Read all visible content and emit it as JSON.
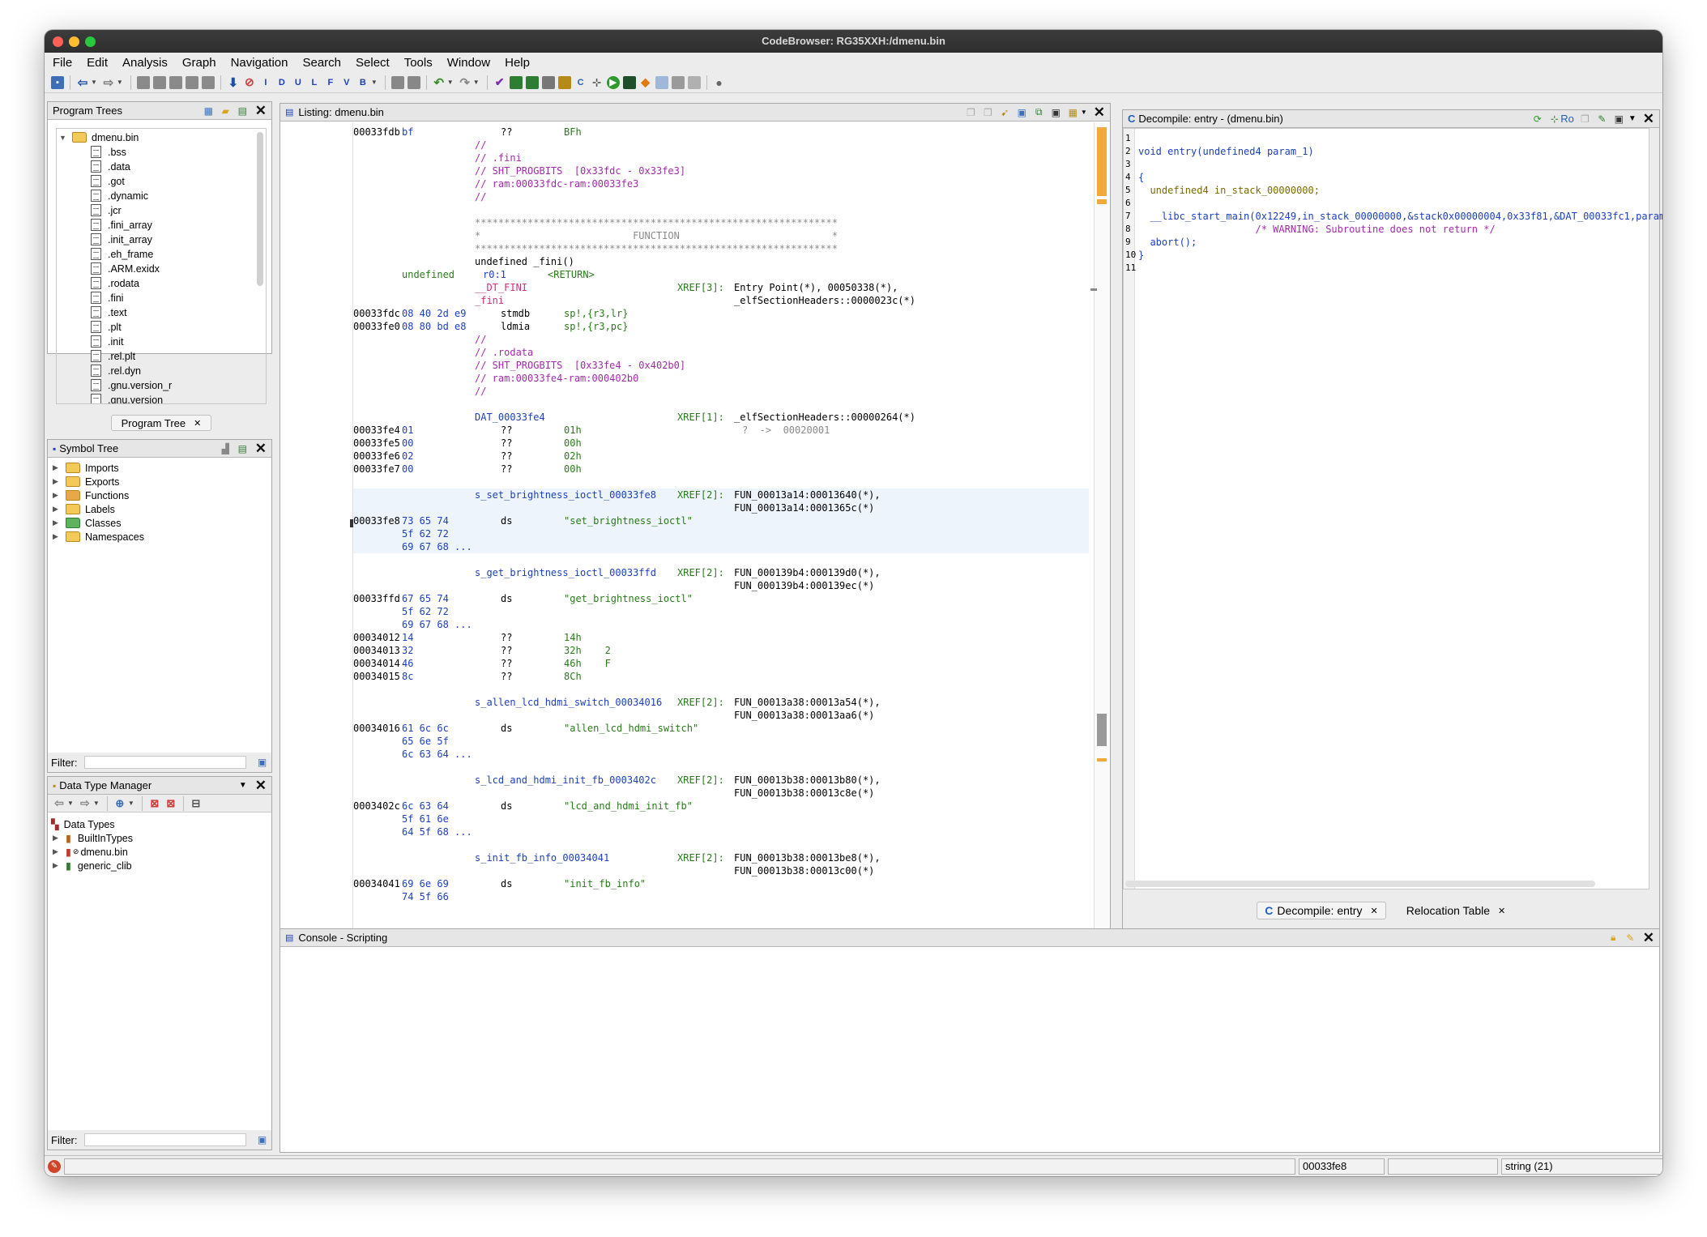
{
  "window": {
    "title": "CodeBrowser: RG35XXH:/dmenu.bin"
  },
  "menu": [
    "File",
    "Edit",
    "Analysis",
    "Graph",
    "Navigation",
    "Search",
    "Select",
    "Tools",
    "Window",
    "Help"
  ],
  "program_trees": {
    "title": "Program Trees",
    "root": "dmenu.bin",
    "items": [
      ".bss",
      ".data",
      ".got",
      ".dynamic",
      ".jcr",
      ".fini_array",
      ".init_array",
      ".eh_frame",
      ".ARM.exidx",
      ".rodata",
      ".fini",
      ".text",
      ".plt",
      ".init",
      ".rel.plt",
      ".rel.dyn",
      ".gnu.version_r",
      ".gnu.version"
    ],
    "tab": "Program Tree"
  },
  "symbol_tree": {
    "title": "Symbol Tree",
    "items": [
      "Imports",
      "Exports",
      "Functions",
      "Labels",
      "Classes",
      "Namespaces"
    ],
    "filter_label": "Filter:"
  },
  "data_type_manager": {
    "title": "Data Type Manager",
    "root": "Data Types",
    "items": [
      "BuiltInTypes",
      "dmenu.bin",
      "generic_clib"
    ],
    "filter_label": "Filter:"
  },
  "listing": {
    "title": "Listing:  dmenu.bin",
    "rows": [
      {
        "addr": "00033fdb",
        "bytes": "bf",
        "mnem": "??",
        "op": "BFh"
      },
      {
        "comment": "//"
      },
      {
        "comment": "// .fini"
      },
      {
        "comment": "// SHT_PROGBITS  [0x33fdc - 0x33fe3]"
      },
      {
        "comment": "// ram:00033fdc-ram:00033fe3"
      },
      {
        "comment": "//"
      },
      {},
      {
        "stars": "**************************************************************"
      },
      {
        "stars": "*                          FUNCTION                          *"
      },
      {
        "stars": "**************************************************************"
      },
      {
        "sig": "undefined _fini()"
      },
      {
        "ret_type": "undefined",
        "ret_reg": "r0:1",
        "ret_tag": "<RETURN>"
      },
      {
        "label_red": "__DT_FINI",
        "xref": "XREF[3]:",
        "xref_vals": "Entry Point(*), 00050338(*),"
      },
      {
        "label_red": "_fini",
        "xref_vals": "_elfSectionHeaders::0000023c(*)"
      },
      {
        "addr": "00033fdc",
        "bytes": "08 40 2d e9",
        "mnem": "stmdb",
        "op": "sp!,{r3,lr}"
      },
      {
        "addr": "00033fe0",
        "bytes": "08 80 bd e8",
        "mnem": "ldmia",
        "op": "sp!,{r3,pc}"
      },
      {
        "comment": "//"
      },
      {
        "comment": "// .rodata"
      },
      {
        "comment": "// SHT_PROGBITS  [0x33fe4 - 0x402b0]"
      },
      {
        "comment": "// ram:00033fe4-ram:000402b0"
      },
      {
        "comment": "//"
      },
      {},
      {
        "label": "DAT_00033fe4",
        "xref": "XREF[1]:",
        "xref_vals": "_elfSectionHeaders::00000264(*)"
      },
      {
        "addr": "00033fe4",
        "bytes": "01",
        "mnem": "??",
        "op": "01h",
        "extra_gray": "?  ->  00020001"
      },
      {
        "addr": "00033fe5",
        "bytes": "00",
        "mnem": "??",
        "op": "00h"
      },
      {
        "addr": "00033fe6",
        "bytes": "02",
        "mnem": "??",
        "op": "02h"
      },
      {
        "addr": "00033fe7",
        "bytes": "00",
        "mnem": "??",
        "op": "00h"
      },
      {},
      {
        "label": "s_set_brightness_ioctl_00033fe8",
        "xref": "XREF[2]:",
        "xref_vals": "FUN_00013a14:00013640(*),",
        "hl": true
      },
      {
        "xref_vals": "FUN_00013a14:0001365c(*)",
        "hl": true
      },
      {
        "addr": "00033fe8",
        "bytes": "73 65 74",
        "mnem": "ds",
        "str": "\"set_brightness_ioctl\"",
        "hl": true
      },
      {
        "bytes": "5f 62 72",
        "hl": true
      },
      {
        "bytes": "69 67 68 ...",
        "hl": true
      },
      {},
      {
        "label": "s_get_brightness_ioctl_00033ffd",
        "xref": "XREF[2]:",
        "xref_vals": "FUN_000139b4:000139d0(*),"
      },
      {
        "xref_vals": "FUN_000139b4:000139ec(*)"
      },
      {
        "addr": "00033ffd",
        "bytes": "67 65 74",
        "mnem": "ds",
        "str": "\"get_brightness_ioctl\""
      },
      {
        "bytes": "5f 62 72"
      },
      {
        "bytes": "69 67 68 ..."
      },
      {
        "addr": "00034012",
        "bytes": "14",
        "mnem": "??",
        "op": "14h"
      },
      {
        "addr": "00034013",
        "bytes": "32",
        "mnem": "??",
        "op": "32h    2"
      },
      {
        "addr": "00034014",
        "bytes": "46",
        "mnem": "??",
        "op": "46h    F"
      },
      {
        "addr": "00034015",
        "bytes": "8c",
        "mnem": "??",
        "op": "8Ch"
      },
      {},
      {
        "label": "s_allen_lcd_hdmi_switch_00034016",
        "xref": "XREF[2]:",
        "xref_vals": "FUN_00013a38:00013a54(*),"
      },
      {
        "xref_vals": "FUN_00013a38:00013aa6(*)"
      },
      {
        "addr": "00034016",
        "bytes": "61 6c 6c",
        "mnem": "ds",
        "str": "\"allen_lcd_hdmi_switch\""
      },
      {
        "bytes": "65 6e 5f"
      },
      {
        "bytes": "6c 63 64 ..."
      },
      {},
      {
        "label": "s_lcd_and_hdmi_init_fb_0003402c",
        "xref": "XREF[2]:",
        "xref_vals": "FUN_00013b38:00013b80(*),"
      },
      {
        "xref_vals": "FUN_00013b38:00013c8e(*)"
      },
      {
        "addr": "0003402c",
        "bytes": "6c 63 64",
        "mnem": "ds",
        "str": "\"lcd_and_hdmi_init_fb\""
      },
      {
        "bytes": "5f 61 6e"
      },
      {
        "bytes": "64 5f 68 ..."
      },
      {},
      {
        "label": "s_init_fb_info_00034041",
        "xref": "XREF[2]:",
        "xref_vals": "FUN_00013b38:00013be8(*),"
      },
      {
        "xref_vals": "FUN_00013b38:00013c00(*)"
      },
      {
        "addr": "00034041",
        "bytes": "69 6e 69",
        "mnem": "ds",
        "str": "\"init_fb_info\""
      },
      {
        "bytes": "74 5f 66"
      }
    ]
  },
  "decompile": {
    "title": "Decompile: entry -  (dmenu.bin)",
    "ro_label": "Ro",
    "lines": [
      "",
      "void entry(undefined4 param_1)",
      "",
      "{",
      "  undefined4 in_stack_00000000;",
      "",
      "  __libc_start_main(0x12249,in_stack_00000000,&stack0x00000004,0x33f81,&DAT_00033fc1,param_",
      "                    /* WARNING: Subroutine does not return */",
      "  abort();",
      "}",
      ""
    ],
    "tabs": [
      "Decompile: entry",
      "Relocation Table"
    ]
  },
  "console": {
    "title": "Console - Scripting"
  },
  "status": {
    "address": "00033fe8",
    "type": "string  (21)"
  }
}
